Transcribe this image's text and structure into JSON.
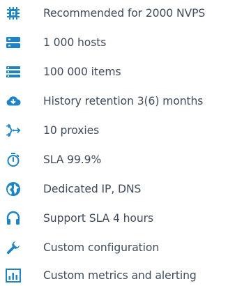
{
  "accent_color": "#1e84c6",
  "text_color": "#3f4a5a",
  "features": [
    {
      "icon": "cpu-chip-icon",
      "label": "Recommended for 2000 NVPS"
    },
    {
      "icon": "server-stack-icon",
      "label": "1 000 hosts"
    },
    {
      "icon": "list-items-icon",
      "label": "100 000 items"
    },
    {
      "icon": "cloud-download-icon",
      "label": "History retention 3(6) months"
    },
    {
      "icon": "proxy-arrows-icon",
      "label": "10 proxies"
    },
    {
      "icon": "stopwatch-icon",
      "label": "SLA 99.9%"
    },
    {
      "icon": "globe-icon",
      "label": "Dedicated IP, DNS"
    },
    {
      "icon": "headphones-icon",
      "label": "Support SLA 4 hours"
    },
    {
      "icon": "wrench-icon",
      "label": "Custom configuration"
    },
    {
      "icon": "bar-chart-icon",
      "label": "Custom metrics and alerting"
    }
  ]
}
